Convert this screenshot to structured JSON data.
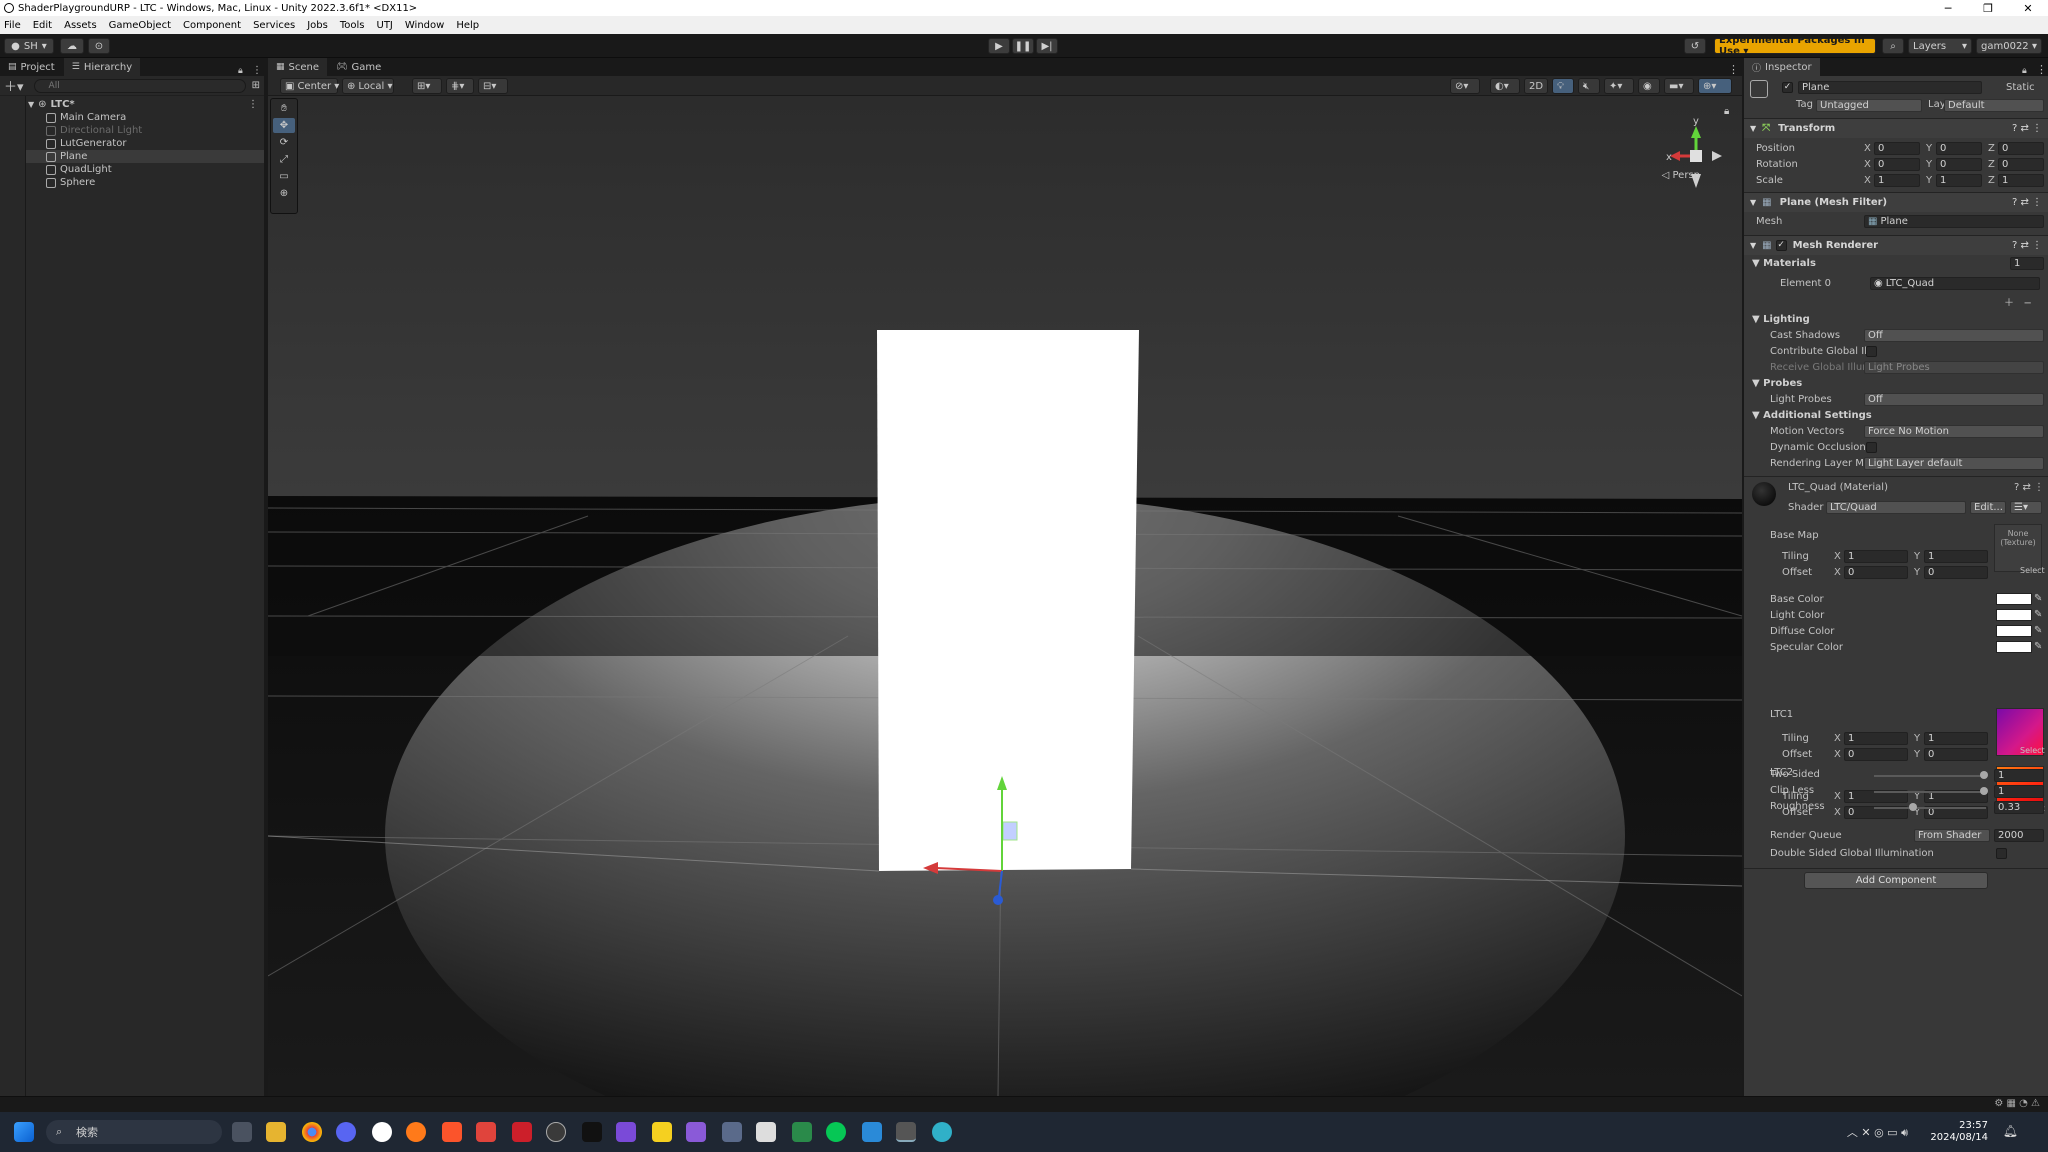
{
  "window": {
    "title": "ShaderPlaygroundURP - LTC - Windows, Mac, Linux - Unity 2022.3.6f1* <DX11>",
    "controls": [
      "─",
      "❐",
      "✕"
    ]
  },
  "menu": [
    "File",
    "Edit",
    "Assets",
    "GameObject",
    "Component",
    "Services",
    "Jobs",
    "Tools",
    "UTJ",
    "Window",
    "Help"
  ],
  "toolbar": {
    "account": "SH",
    "experimental": "Experimental Packages In Use ▾",
    "layers": "Layers",
    "layout": "gam0022",
    "play_icon": "play-icon",
    "pause_icon": "pause-icon",
    "step_icon": "step-icon"
  },
  "hierarchy": {
    "tabs": [
      "Project",
      "Hierarchy"
    ],
    "search_placeholder": "All",
    "scene": "LTC*",
    "items": [
      {
        "label": "Main Camera",
        "enabled": true,
        "selected": false
      },
      {
        "label": "Directional Light",
        "enabled": false,
        "selected": false
      },
      {
        "label": "LutGenerator",
        "enabled": true,
        "selected": false
      },
      {
        "label": "Plane",
        "enabled": true,
        "selected": true
      },
      {
        "label": "QuadLight",
        "enabled": true,
        "selected": false
      },
      {
        "label": "Sphere",
        "enabled": true,
        "selected": false
      }
    ]
  },
  "scene": {
    "tabs": [
      "Scene",
      "Game"
    ],
    "pivot": "Center",
    "space": "Local",
    "mode_2d": "2D",
    "projection": "Persp",
    "axis_x": "x",
    "axis_y": "y"
  },
  "inspector": {
    "tab": "Inspector",
    "object_name": "Plane",
    "static_label": "Static",
    "tag_label": "Tag",
    "tag": "Untagged",
    "layer_label": "Layer",
    "layer": "Default",
    "transform": {
      "title": "Transform",
      "rows": [
        {
          "label": "Position",
          "x": "0",
          "y": "0",
          "z": "0"
        },
        {
          "label": "Rotation",
          "x": "0",
          "y": "0",
          "z": "0"
        },
        {
          "label": "Scale",
          "x": "1",
          "y": "1",
          "z": "1"
        }
      ]
    },
    "mesh_filter": {
      "title": "Plane (Mesh Filter)",
      "mesh_label": "Mesh",
      "mesh": "Plane"
    },
    "mesh_renderer": {
      "title": "Mesh Renderer",
      "materials_label": "Materials",
      "materials_count": "1",
      "element_label": "Element 0",
      "element_value": "LTC_Quad",
      "lighting_label": "Lighting",
      "cast_shadows_label": "Cast Shadows",
      "cast_shadows": "Off",
      "contribute_gi_label": "Contribute Global Illu",
      "receive_gi_label": "Receive Global Illumi",
      "receive_gi": "Light Probes",
      "probes_label": "Probes",
      "light_probes_label": "Light Probes",
      "light_probes": "Off",
      "additional_label": "Additional Settings",
      "motion_vectors_label": "Motion Vectors",
      "motion_vectors": "Force No Motion",
      "dynamic_occlusion_label": "Dynamic Occlusion",
      "rendering_layer_label": "Rendering Layer Mas",
      "rendering_layer": "Light Layer default"
    },
    "material": {
      "title": "LTC_Quad (Material)",
      "shader_label": "Shader",
      "shader": "LTC/Quad",
      "edit_label": "Edit...",
      "base_map_label": "Base Map",
      "none_texture": "None\n(Texture)",
      "tiling_label": "Tiling",
      "offset_label": "Offset",
      "select_label": "Select",
      "base_tiling": {
        "x": "1",
        "y": "1"
      },
      "base_offset": {
        "x": "0",
        "y": "0"
      },
      "colors": [
        {
          "label": "Base Color",
          "hex": "#ffffff"
        },
        {
          "label": "Light Color",
          "hex": "#ffffff"
        },
        {
          "label": "Diffuse Color",
          "hex": "#ffffff"
        },
        {
          "label": "Specular Color",
          "hex": "#ffffff"
        }
      ],
      "ltc1_label": "LTC1",
      "ltc1_tiling": {
        "x": "1",
        "y": "1"
      },
      "ltc1_offset": {
        "x": "0",
        "y": "0"
      },
      "ltc2_label": "LTC2",
      "ltc2_tiling": {
        "x": "1",
        "y": "1"
      },
      "ltc2_offset": {
        "x": "0",
        "y": "0"
      },
      "two_sided_label": "Two Sided",
      "two_sided": "1",
      "two_sided_level": 1.0,
      "clip_less_label": "Clip Less",
      "clip_less": "1",
      "clip_less_level": 1.0,
      "roughness_label": "Roughness",
      "roughness": "0.33",
      "roughness_level": 0.33,
      "render_queue_label": "Render Queue",
      "render_queue_mode": "From Shader",
      "render_queue": "2000",
      "double_sided_gi_label": "Double Sided Global Illumination"
    },
    "add_component": "Add Component"
  },
  "taskbar": {
    "search_placeholder": "検索",
    "time": "23:57",
    "date": "2024/08/14"
  },
  "colors": {
    "accent": "#46607c",
    "experimental": "#e9a400",
    "gizmo_x": "#d43a3a",
    "gizmo_y": "#62d43a",
    "gizmo_z": "#2a5bd4"
  }
}
